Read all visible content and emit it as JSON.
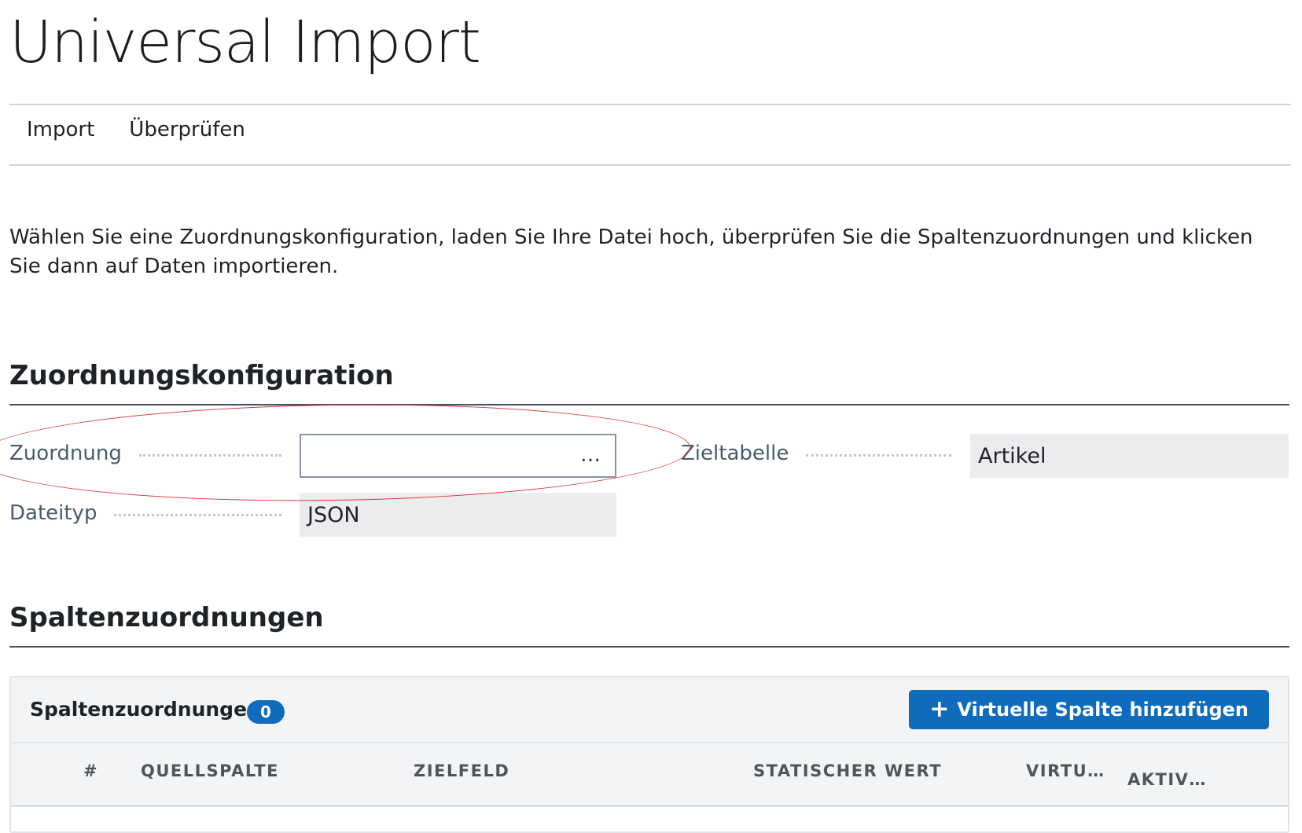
{
  "page": {
    "title": "Universal Import"
  },
  "tabs": [
    {
      "label": "Import"
    },
    {
      "label": "Überprüfen"
    }
  ],
  "intro": "Wählen Sie eine Zuordnungskonfiguration, laden Sie Ihre Datei hoch, überprüfen Sie die Spaltenzuordnungen und klicken Sie dann auf Daten importieren.",
  "config": {
    "heading": "Zuordnungskonfiguration",
    "mapping": {
      "label": "Zuordnung",
      "value": "",
      "lookup_icon": "…"
    },
    "target_table": {
      "label": "Zieltabelle",
      "value": "Artikel"
    },
    "file_type": {
      "label": "Dateityp",
      "value": "JSON"
    }
  },
  "mappings": {
    "heading": "Spaltenzuordnungen",
    "grid_title": "Spaltenzuordnungen",
    "count": "0",
    "add_button": "Virtuelle Spalte hinzufügen",
    "add_icon": "+",
    "columns": [
      "#",
      "QUELLSPALTE",
      "ZIELFELD",
      "STATISCHER WERT",
      "VIRTU…",
      "AKTIV…"
    ]
  },
  "colors": {
    "accent": "#0f6cbd",
    "annotation": "#e03030"
  }
}
